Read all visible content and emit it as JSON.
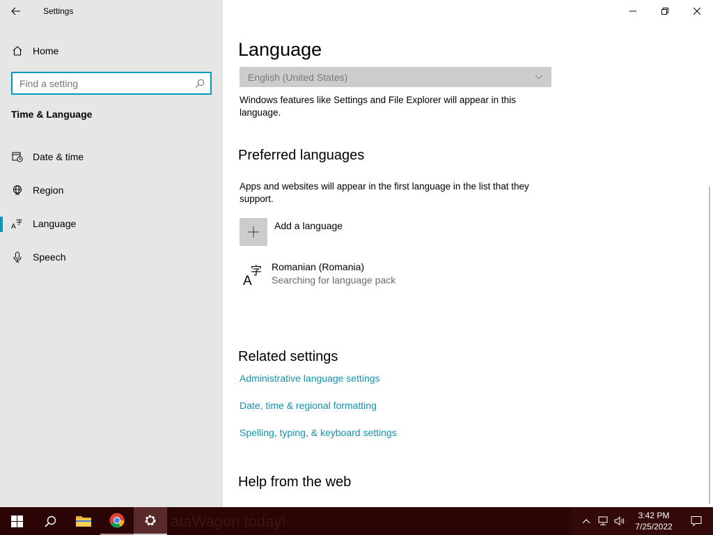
{
  "app": {
    "title": "Settings"
  },
  "sidebar": {
    "home_label": "Home",
    "search_placeholder": "Find a setting",
    "section_title": "Time & Language",
    "items": [
      {
        "label": "Date & time",
        "icon": "calendar-clock-icon"
      },
      {
        "label": "Region",
        "icon": "globe-icon"
      },
      {
        "label": "Language",
        "icon": "language-icon",
        "selected": true
      },
      {
        "label": "Speech",
        "icon": "microphone-icon"
      }
    ]
  },
  "main": {
    "title": "Language",
    "display_language": {
      "value": "English (United States)"
    },
    "display_language_desc": "Windows features like Settings and File Explorer will appear in this language.",
    "preferred": {
      "heading": "Preferred languages",
      "desc": "Apps and websites will appear in the first language in the list that they support.",
      "add_label": "Add a language",
      "languages": [
        {
          "name": "Romanian (Romania)",
          "status": "Searching for language pack"
        }
      ]
    },
    "related": {
      "heading": "Related settings",
      "links": [
        "Administrative language settings",
        "Date, time & regional formatting",
        "Spelling, typing, & keyboard settings"
      ]
    },
    "help_heading": "Help from the web"
  },
  "taskbar": {
    "wallpaper_text": "ataWagon today!",
    "time": "3:42 PM",
    "date": "7/25/2022"
  },
  "colors": {
    "accent": "#0099bc",
    "link": "#0f93b1",
    "sidebar_bg": "#e6e6e6",
    "taskbar_bg": "#2b0505"
  }
}
